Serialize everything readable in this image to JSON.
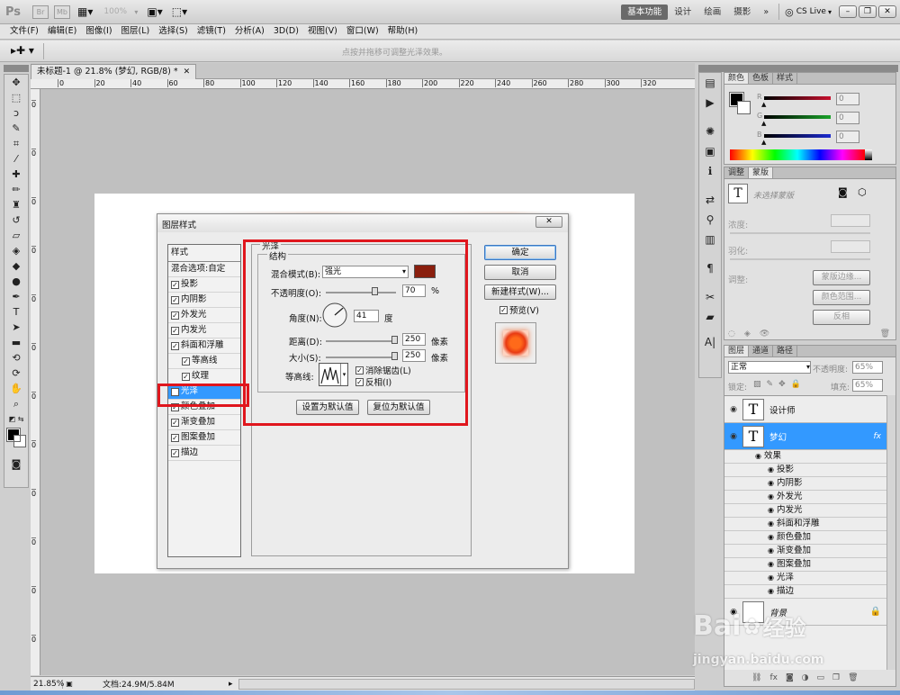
{
  "app": {
    "logo": "Ps",
    "zoom_display": "100%",
    "workspaces": [
      "基本功能",
      "设计",
      "绘画",
      "摄影"
    ],
    "more_glyph": "»",
    "cslive": "CS Live"
  },
  "menu": [
    "文件(F)",
    "编辑(E)",
    "图像(I)",
    "图层(L)",
    "选择(S)",
    "滤镜(T)",
    "分析(A)",
    "3D(D)",
    "视图(V)",
    "窗口(W)",
    "帮助(H)"
  ],
  "options_hint": "点按并拖移可调整光泽效果。",
  "document": {
    "tab_title": "未标题-1 @ 21.8% (梦幻, RGB/8) *",
    "ruler_h": [
      "0",
      "20",
      "40",
      "60",
      "80",
      "100",
      "120",
      "140",
      "160",
      "180",
      "200",
      "220",
      "240",
      "260",
      "280",
      "300",
      "320"
    ],
    "ruler_v": [
      "0",
      "0",
      "0",
      "0",
      "0",
      "0",
      "0",
      "0",
      "0",
      "0",
      "0",
      "0"
    ],
    "zoom": "21.85%",
    "doc_info": "文档:24.9M/5.84M"
  },
  "dialog": {
    "title": "图层样式",
    "list_header": "样式",
    "blend_opts": "混合选项:自定",
    "styles": [
      {
        "label": "投影",
        "checked": true,
        "sub": false
      },
      {
        "label": "内阴影",
        "checked": true,
        "sub": false
      },
      {
        "label": "外发光",
        "checked": true,
        "sub": false
      },
      {
        "label": "内发光",
        "checked": true,
        "sub": false
      },
      {
        "label": "斜面和浮雕",
        "checked": true,
        "sub": false
      },
      {
        "label": "等高线",
        "checked": true,
        "sub": true
      },
      {
        "label": "纹理",
        "checked": true,
        "sub": true
      },
      {
        "label": "光泽",
        "checked": true,
        "sub": false,
        "selected": true
      },
      {
        "label": "颜色叠加",
        "checked": true,
        "sub": false
      },
      {
        "label": "渐变叠加",
        "checked": true,
        "sub": false
      },
      {
        "label": "图案叠加",
        "checked": true,
        "sub": false
      },
      {
        "label": "描边",
        "checked": true,
        "sub": false
      }
    ],
    "section_title": "光泽",
    "group_title": "结构",
    "blend_label": "混合模式(B):",
    "blend_value": "强光",
    "color_swatch": "#8a1f0e",
    "opacity_label": "不透明度(O):",
    "opacity_value": "70",
    "opacity_pct": 0.7,
    "percent": "%",
    "angle_label": "角度(N):",
    "angle_value": "41",
    "degree": "度",
    "distance_label": "距离(D):",
    "distance_value": "250",
    "size_label": "大小(S):",
    "size_value": "250",
    "pixels": "像素",
    "contour_label": "等高线:",
    "antialias_label": "消除锯齿(L)",
    "invert_label": "反相(I)",
    "set_default_btn": "设置为默认值",
    "reset_default_btn": "复位为默认值",
    "ok_btn": "确定",
    "cancel_btn": "取消",
    "new_style_btn": "新建样式(W)...",
    "preview_label": "预览(V)",
    "highlight_color": "#e0161d"
  },
  "color_panel": {
    "tabs": [
      "颜色",
      "色板",
      "样式"
    ],
    "channels": [
      {
        "label": "R",
        "value": "0",
        "color": "#c8102e"
      },
      {
        "label": "G",
        "value": "0",
        "color": "#1aa32a"
      },
      {
        "label": "B",
        "value": "0",
        "color": "#1c2ad0"
      }
    ]
  },
  "adjust_panel": {
    "tabs": [
      "调整",
      "蒙版"
    ],
    "hint": "未选择蒙版",
    "density": "浓度:",
    "feather": "羽化:",
    "refine": "调整:",
    "mask_edge": "蒙版边缘...",
    "color_range": "颜色范围...",
    "invert": "反相"
  },
  "layers_panel": {
    "tabs": [
      "图层",
      "通道",
      "路径"
    ],
    "blend_mode": "正常",
    "opacity_label": "不透明度:",
    "opacity_value": "65%",
    "lock_label": "锁定:",
    "fill_label": "填充:",
    "fill_value": "65%",
    "layers": [
      {
        "name": "设计师",
        "type": "text",
        "selected": false
      },
      {
        "name": "梦幻",
        "type": "text",
        "selected": true,
        "fx": "fx"
      }
    ],
    "effects_label": "效果",
    "effects": [
      "投影",
      "内阴影",
      "外发光",
      "内发光",
      "斜面和浮雕",
      "颜色叠加",
      "渐变叠加",
      "图案叠加",
      "光泽",
      "描边"
    ],
    "background_layer": "背景"
  },
  "watermark": {
    "text_main": "Bai",
    "text_cn": "经验",
    "text_url": "jingyan.baidu.com"
  }
}
